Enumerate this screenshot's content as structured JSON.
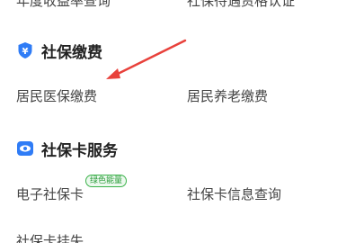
{
  "top_row": {
    "left_text": "年度收益率查询",
    "right_text": "社保待遇资格认证"
  },
  "sections": [
    {
      "title": "社保缴费",
      "icon": "shield-yen-icon",
      "items": [
        "居民医保缴费",
        "居民养老缴费"
      ]
    },
    {
      "title": "社保卡服务",
      "icon": "card-eye-icon",
      "items": [
        "电子社保卡",
        "社保卡信息查询",
        "社保卡挂失"
      ],
      "badge": "绿色能量"
    }
  ],
  "colors": {
    "accent_blue": "#2f7cf6",
    "arrow_red": "#e8413b",
    "badge_green": "#3bb24a"
  }
}
